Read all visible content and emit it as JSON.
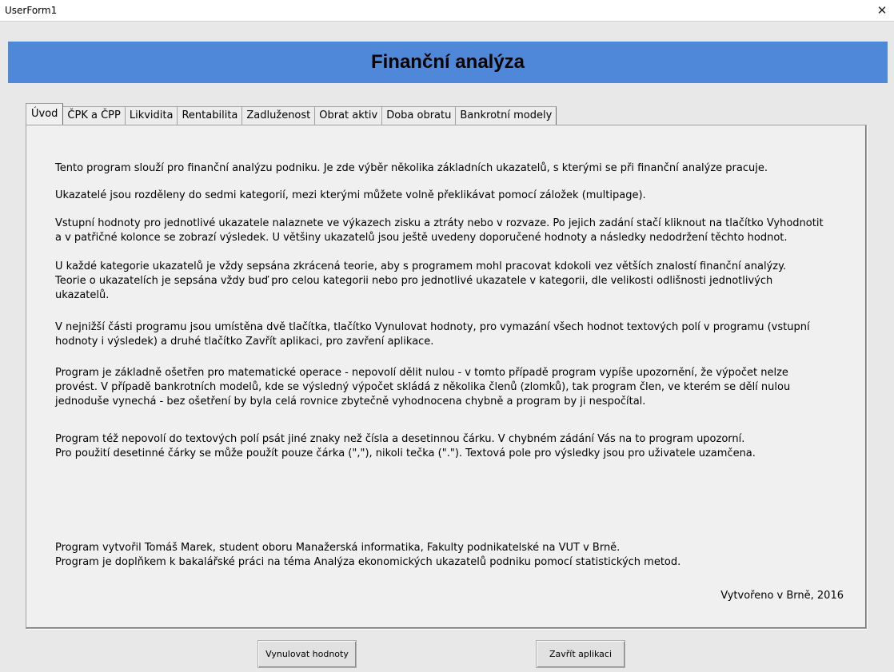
{
  "window": {
    "title": "UserForm1",
    "close_icon": "close-icon"
  },
  "header": {
    "title": "Finanční analýza",
    "background": "#4f88d8"
  },
  "tabs": [
    {
      "label": "Úvod",
      "active": true
    },
    {
      "label": "ČPK a ČPP",
      "active": false
    },
    {
      "label": "Likvidita",
      "active": false
    },
    {
      "label": "Rentabilita",
      "active": false
    },
    {
      "label": "Zadluženost",
      "active": false
    },
    {
      "label": "Obrat aktiv",
      "active": false
    },
    {
      "label": "Doba obratu",
      "active": false
    },
    {
      "label": "Bankrotní modely",
      "active": false
    }
  ],
  "content": {
    "paragraphs": [
      "Tento program slouží pro finanční analýzu podniku. Je zde výběr několika základních ukazatelů, s kterými se při finanční analýze pracuje.",
      "Ukazatelé jsou rozděleny do sedmi kategorií, mezi kterými můžete volně překlikávat pomocí záložek (multipage).",
      "Vstupní hodnoty pro jednotlivé ukazatele nalaznete ve výkazech zisku a ztráty nebo v rozvaze. Po jejich zadání stačí kliknout na tlačítko Vyhodnotit\na v patřičné kolonce se zobrazí výsledek. U většiny ukazatelů jsou ještě uvedeny doporučené hodnoty a následky nedodržení těchto hodnot.",
      "U každé kategorie ukazatelů je vždy sepsána zkrácená teorie, aby s programem mohl pracovat kdokoli vez větších znalostí finanční analýzy.\nTeorie o ukazatelích je sepsána vždy buď pro celou kategorii nebo pro jednotlivé ukazatele v kategorii, dle velikosti odlišnosti jednotlivých\nukazatelů.",
      "V nejnižší části programu jsou umístěna dvě tlačítka, tlačítko Vynulovat hodnoty, pro vymazání všech hodnot textových polí v programu (vstupní\nhodnoty i výsledek) a druhé tlačítko Zavřít aplikaci, pro zavření aplikace.",
      "Program je základně ošetřen pro matematické operace - nepovolí dělit nulou - v tomto případě program vypíše upozornění, že výpočet nelze\nprovést. V případě bankrotních modelů, kde se výsledný výpočet skládá z několika členů (zlomků), tak program člen, ve kterém se dělí nulou\njednoduše vynechá - bez ošetření by byla celá rovnice zbytečně vyhodnocena chybně a program by ji nespočítal.",
      "Program též nepovolí do textových polí psát jiné znaky než čísla a desetinnou čárku. V chybném zádání Vás na to program upozorní.\nPro použití desetinné čárky se může použít pouze čárka (\",\"), nikoli tečka (\".\"). Textová pole pro výsledky jsou pro uživatele uzamčena.",
      "Program vytvořil Tomáš Marek, student oboru Manažerská informatika, Fakulty podnikatelské na VUT v Brně.\nProgram je doplňkem k bakalářské práci na téma Analýza ekonomických ukazatelů podniku pomocí statistických metod."
    ],
    "signature": "Vytvořeno v Brně, 2016"
  },
  "buttons": {
    "reset_label": "Vynulovat hodnoty",
    "close_label": "Zavřít aplikaci"
  }
}
